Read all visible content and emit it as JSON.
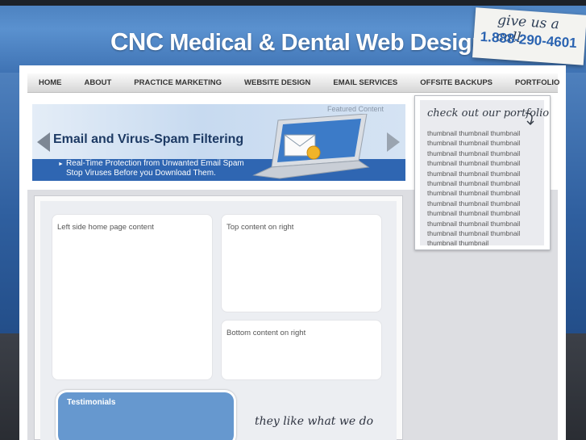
{
  "header": {
    "logo_brand": "CNC",
    "logo_rest": "Medical & Dental Web Design",
    "call_prompt": "give us a call",
    "phone": "1.888-290-4601"
  },
  "nav": {
    "items": [
      {
        "label": "HOME"
      },
      {
        "label": "ABOUT"
      },
      {
        "label": "PRACTICE MARKETING"
      },
      {
        "label": "WEBSITE DESIGN"
      },
      {
        "label": "EMAIL SERVICES"
      },
      {
        "label": "OFFSITE BACKUPS"
      },
      {
        "label": "PORTFOLIO"
      }
    ]
  },
  "banner": {
    "featured_label": "Featured Content",
    "title": "Email and Virus-Spam Filtering",
    "line1": "Real-Time Protection from Unwanted Email Spam",
    "line2": "Stop Viruses Before you Download Them."
  },
  "content": {
    "left_box": "Left side home page content",
    "top_right_box": "Top content on right",
    "bottom_right_box": "Bottom content on right",
    "testimonials_title": "Testimonials",
    "tagline": "they like what we do"
  },
  "portfolio": {
    "heading": "check out our portfolio",
    "thumbnail_label": "thumbnail",
    "thumbnail_count": 35
  },
  "colors": {
    "brand_blue": "#2f66b2",
    "phone_blue": "#2a63b1",
    "testimonials_blue": "#6698cf"
  }
}
